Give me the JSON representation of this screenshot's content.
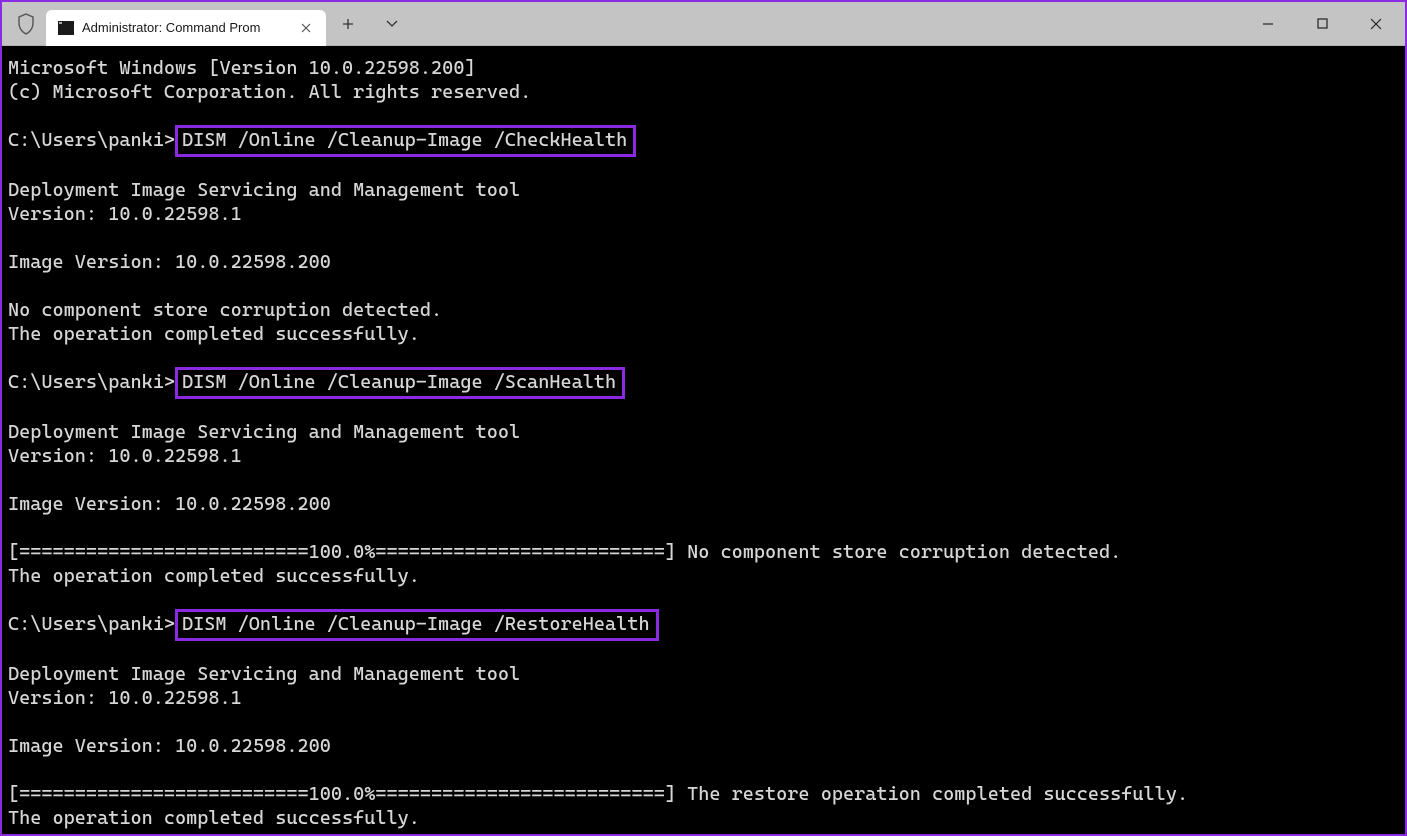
{
  "tab": {
    "title": "Administrator: Command Prom"
  },
  "terminal": {
    "line1": "Microsoft Windows [Version 10.0.22598.200]",
    "line2": "(c) Microsoft Corporation. All rights reserved.",
    "prompt": "C:\\Users\\panki>",
    "cmd1": "DISM /Online /Cleanup-Image /CheckHealth",
    "cmd2": "DISM /Online /Cleanup-Image /ScanHealth",
    "cmd3": "DISM /Online /Cleanup-Image /RestoreHealth",
    "dism_header": "Deployment Image Servicing and Management tool",
    "dism_version": "Version: 10.0.22598.1",
    "image_version": "Image Version: 10.0.22598.200",
    "no_corruption": "No component store corruption detected.",
    "op_success": "The operation completed successfully.",
    "progress_nocorrupt": "[==========================100.0%==========================] No component store corruption detected.",
    "progress_restore": "[==========================100.0%==========================] The restore operation completed successfully."
  }
}
